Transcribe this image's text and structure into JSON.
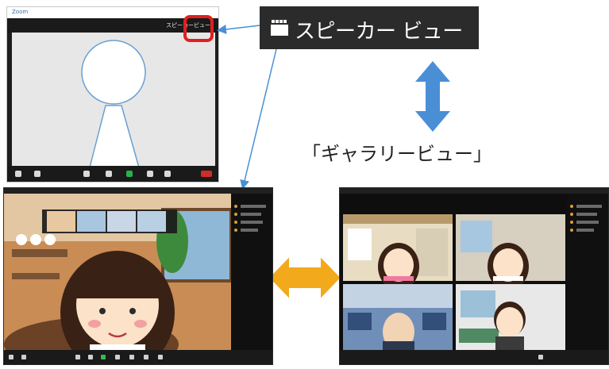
{
  "top_window": {
    "title": "Zoom",
    "view_button_label": "スピーカービュー"
  },
  "speaker_label": {
    "icon": "gallery-grid-icon",
    "text": "スピーカー ビュー"
  },
  "gallery_label": "「ギャラリービュー」",
  "colors": {
    "highlight_red": "#e11f1f",
    "arrow_blue": "#4a8fd6",
    "arrow_orange": "#f2a91c",
    "zoom_dark": "#1a1a1a"
  }
}
